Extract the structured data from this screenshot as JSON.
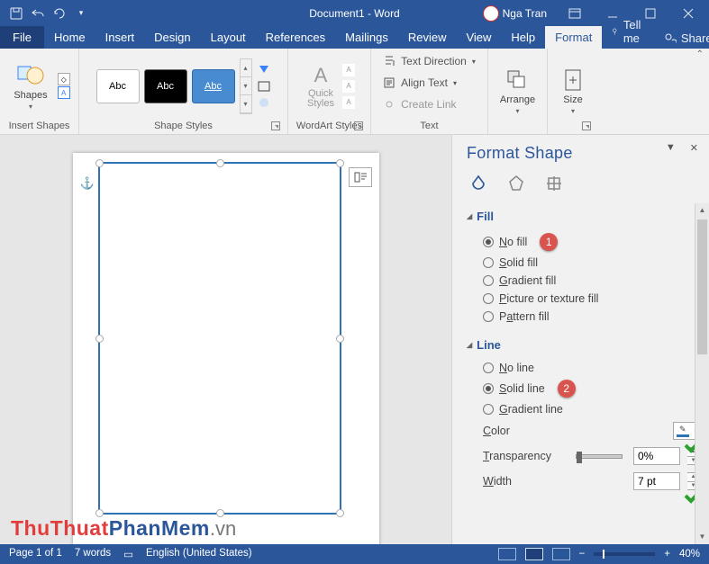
{
  "titlebar": {
    "document_title": "Document1 - Word",
    "user_name": "Nga Tran"
  },
  "tabs": {
    "file": "File",
    "items": [
      "Home",
      "Insert",
      "Design",
      "Layout",
      "References",
      "Mailings",
      "Review",
      "View",
      "Help",
      "Format"
    ],
    "active": "Format",
    "tell_me": "Tell me",
    "share": "Share"
  },
  "ribbon": {
    "insert_shapes": {
      "shapes": "Shapes",
      "group": "Insert Shapes"
    },
    "shape_styles": {
      "sample": "Abc",
      "group": "Shape Styles"
    },
    "wordart": {
      "quick_styles": "Quick\nStyles",
      "group": "WordArt Styles"
    },
    "text": {
      "direction": "Text Direction",
      "align": "Align Text",
      "create_link": "Create Link",
      "group": "Text"
    },
    "arrange": {
      "label": "Arrange"
    },
    "size": {
      "label": "Size"
    }
  },
  "pane": {
    "title": "Format Shape",
    "fill": {
      "heading": "Fill",
      "options": [
        "No fill",
        "Solid fill",
        "Gradient fill",
        "Picture or texture fill",
        "Pattern fill"
      ],
      "selected": "No fill",
      "badge": "1"
    },
    "line": {
      "heading": "Line",
      "options": [
        "No line",
        "Solid line",
        "Gradient line"
      ],
      "selected": "Solid line",
      "badge": "2",
      "color_label": "Color",
      "transparency_label": "Transparency",
      "transparency_value": "0%",
      "width_label": "Width",
      "width_value": "7 pt"
    }
  },
  "statusbar": {
    "page": "Page 1 of 1",
    "words": "7 words",
    "language": "English (United States)",
    "zoom": "40%"
  },
  "watermark": {
    "part1": "ThuThuat",
    "part2": "PhanMem",
    "part3": ".vn"
  }
}
